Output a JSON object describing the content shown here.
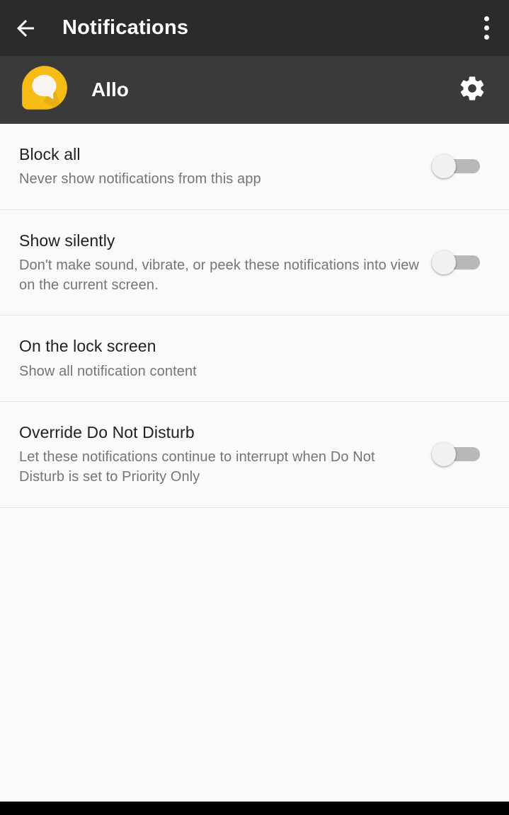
{
  "toolbar": {
    "back_icon": "arrow-left-icon",
    "title": "Notifications",
    "overflow_icon": "more-vertical-icon",
    "background_color": "#2b2b2b",
    "text_color": "#ffffff"
  },
  "app_header": {
    "app_icon": "allo-app-icon",
    "app_icon_color": "#f5bc16",
    "app_name": "Allo",
    "settings_icon": "gear-icon",
    "background_color": "#3a3a3a"
  },
  "settings": {
    "rows": [
      {
        "title": "Block all",
        "subtitle": "Never show notifications from this app",
        "control": "switch",
        "switch_state": "off",
        "name": "block-all"
      },
      {
        "title": "Show silently",
        "subtitle": "Don't make sound, vibrate, or peek these notifications into view on the current screen.",
        "control": "switch",
        "switch_state": "off",
        "name": "show-silently"
      },
      {
        "title": "On the lock screen",
        "subtitle": "Show all notification content",
        "control": "none",
        "switch_state": "",
        "name": "on-the-lock-screen"
      },
      {
        "title": "Override Do Not Disturb",
        "subtitle": "Let these notifications continue to interrupt when Do Not Disturb is set to Priority Only",
        "control": "switch",
        "switch_state": "off",
        "name": "override-do-not-disturb"
      }
    ]
  },
  "colors": {
    "content_background": "#fafafa",
    "divider": "#e4e4e4",
    "title_text": "#212121",
    "subtitle_text": "#757575",
    "switch_track_off": "#b8b8b8",
    "switch_thumb_off": "#f1f1f1",
    "navbar": "#000000"
  }
}
